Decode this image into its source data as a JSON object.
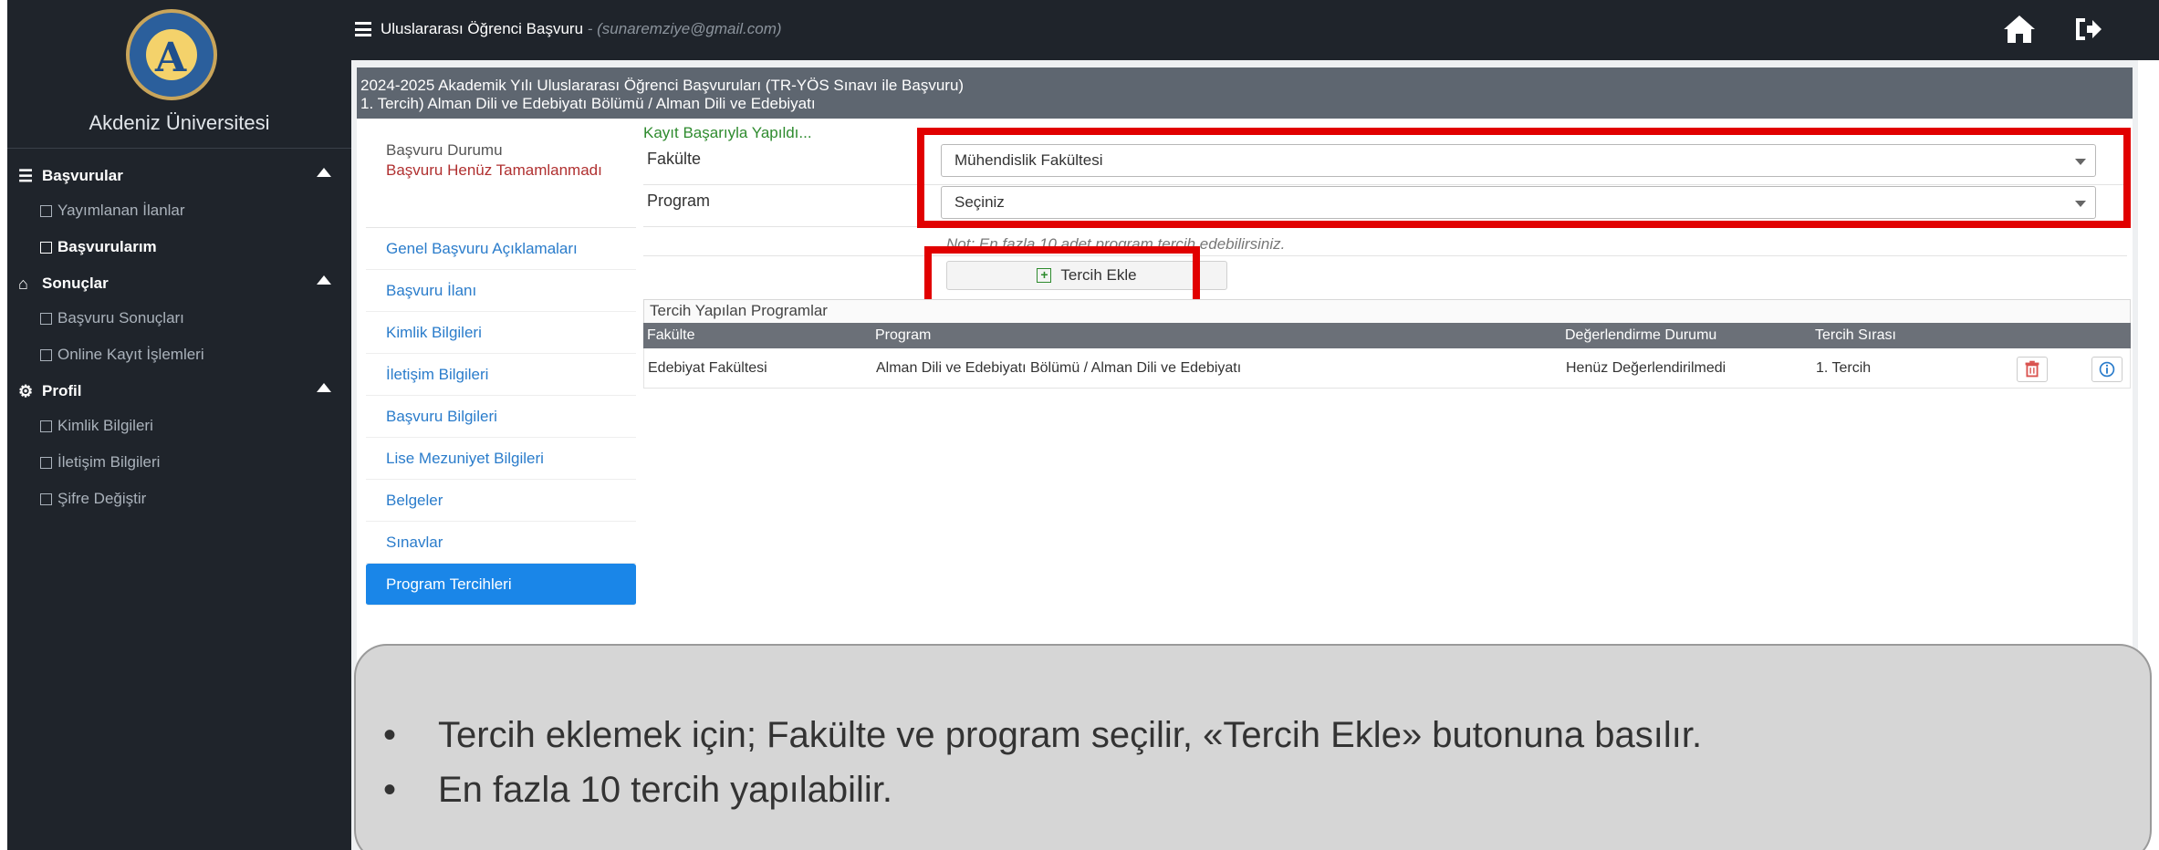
{
  "sidebar": {
    "university_name": "Akdeniz Üniversitesi",
    "sections": [
      {
        "label": "Başvurular",
        "icon": "server-icon",
        "items": [
          {
            "label": "Yayımlanan İlanlar",
            "active": false
          },
          {
            "label": "Başvurularım",
            "active": true
          }
        ]
      },
      {
        "label": "Sonuçlar",
        "icon": "inbox-icon",
        "items": [
          {
            "label": "Başvuru Sonuçları",
            "active": false
          },
          {
            "label": "Online Kayıt İşlemleri",
            "active": false
          }
        ]
      },
      {
        "label": "Profil",
        "icon": "gears-icon",
        "items": [
          {
            "label": "Kimlik Bilgileri",
            "active": false
          },
          {
            "label": "İletişim Bilgileri",
            "active": false
          },
          {
            "label": "Şifre Değiştir",
            "active": false
          }
        ]
      }
    ]
  },
  "topbar": {
    "title": "Uluslararası Öğrenci Başvuru",
    "email": " - (sunaremziye@gmail.com)"
  },
  "panel": {
    "heading_line1": "2024-2025 Akademik Yılı Uluslararası Öğrenci Başvuruları (TR-YÖS Sınavı ile Başvuru)",
    "heading_line2": "1. Tercih) Alman Dili ve Edebiyatı Bölümü / Alman Dili ve Edebiyatı"
  },
  "tabs": {
    "status_title": "Başvuru Durumu",
    "status_value": "Başvuru Henüz Tamamlanmadı",
    "items": [
      "Genel Başvuru Açıklamaları",
      "Başvuru İlanı",
      "Kimlik Bilgileri",
      "İletişim Bilgileri",
      "Başvuru Bilgileri",
      "Lise Mezuniyet Bilgileri",
      "Belgeler",
      "Sınavlar",
      "Program Tercihleri"
    ],
    "active_index": 8
  },
  "form": {
    "success_message": "Kayıt Başarıyla Yapıldı...",
    "faculty_label": "Fakülte",
    "faculty_value": "Mühendislik Fakültesi",
    "program_label": "Program",
    "program_value": "Seçiniz",
    "note": "Not: En fazla 10 adet program tercih edebilirsiniz.",
    "add_button": "Tercih Ekle"
  },
  "table": {
    "title": "Tercih Yapılan Programlar",
    "headers": [
      "Fakülte",
      "Program",
      "Değerlendirme Durumu",
      "Tercih Sırası"
    ],
    "rows": [
      [
        "Edebiyat Fakültesi",
        "Alman Dili ve Edebiyatı Bölümü / Alman Dili ve Edebiyatı",
        "Henüz Değerlendirilmedi",
        "1. Tercih"
      ]
    ]
  },
  "callout": {
    "bullet1": "Tercih eklemek için; Fakülte ve program seçilir,  «Tercih Ekle» butonuna basılır.",
    "bullet2": "En fazla 10 tercih yapılabilir."
  },
  "colors": {
    "sidebar_bg": "#1f242b",
    "active_tab": "#1a86e8",
    "highlight": "#e10000",
    "success": "#2e8b2e"
  }
}
